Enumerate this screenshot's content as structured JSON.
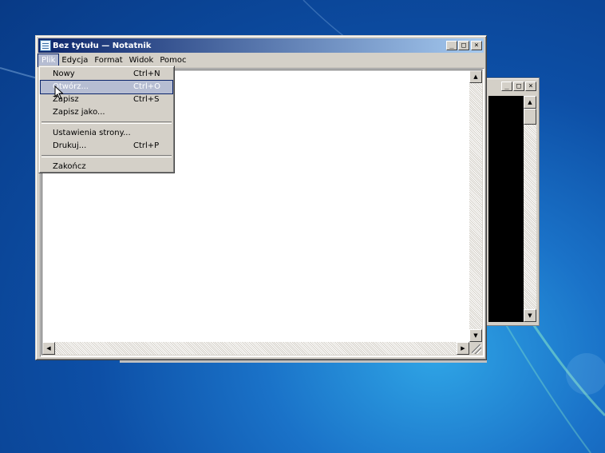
{
  "notepad": {
    "title": "Bez tytułu — Notatnik",
    "menu": [
      "Plik",
      "Edycja",
      "Format",
      "Widok",
      "Pomoc"
    ],
    "active_menu_index": 0
  },
  "file_menu": {
    "items": [
      {
        "label": "Nowy",
        "shortcut": "Ctrl+N"
      },
      {
        "label": "Otwórz...",
        "shortcut": "Ctrl+O",
        "highlighted": true
      },
      {
        "label": "Zapisz",
        "shortcut": "Ctrl+S"
      },
      {
        "label": "Zapisz jako...",
        "shortcut": ""
      },
      {
        "label": "Ustawienia strony...",
        "shortcut": ""
      },
      {
        "label": "Drukuj...",
        "shortcut": "Ctrl+P"
      },
      {
        "label": "Zakończ",
        "shortcut": ""
      }
    ]
  },
  "caption_buttons": {
    "minimize": "_",
    "maximize": "□",
    "close": "×"
  },
  "colors": {
    "title_start": "#0a246a",
    "title_end": "#a6caf0",
    "menu_highlight": "#b6bdd2",
    "window_face": "#d4d0c8",
    "desktop": "#0d4fa6"
  },
  "icons": {
    "app": "notepad-icon",
    "cursor": "mouse-pointer-icon"
  }
}
